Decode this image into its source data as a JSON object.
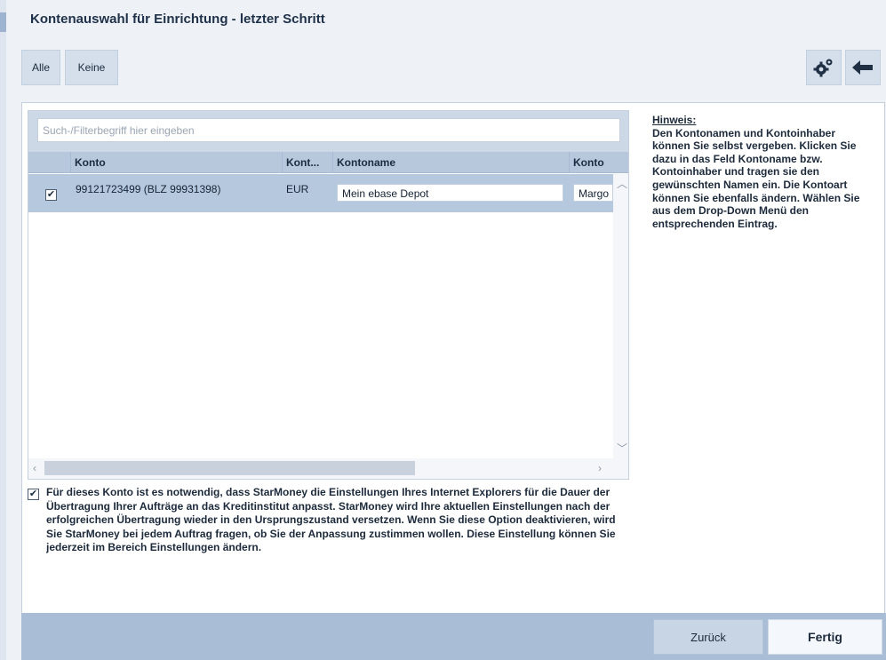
{
  "page": {
    "title": "Kontenauswahl für Einrichtung - letzter Schritt"
  },
  "toolbar": {
    "alle_label": "Alle",
    "keine_label": "Keine",
    "settings_icon": "gear-icon",
    "back_icon": "arrow-left-icon"
  },
  "grid": {
    "search_placeholder": "Such-/Filterbegriff hier eingeben",
    "columns": [
      "Konto",
      "Kont...",
      "Kontoname",
      "Konto"
    ],
    "rows": [
      {
        "checked": true,
        "konto": "99121723499 (BLZ 99931398)",
        "waehrung": "EUR",
        "kontoname": "Mein ebase Depot",
        "kontoinhaber": "Margo"
      }
    ]
  },
  "hint": {
    "title": "Hinweis:",
    "text": "Den Kontonamen und Kontoinhaber können Sie selbst vergeben. Klicken Sie dazu in das Feld Kontoname bzw. Kontoinhaber und tragen sie den gewünschten Namen ein. Die Kontoart können Sie ebenfalls ändern. Wählen Sie aus dem Drop-Down Menü den entsprechenden Eintrag."
  },
  "option": {
    "checked": true,
    "text": "Für dieses Konto ist es notwendig, dass StarMoney die Einstellungen Ihres Internet Explorers für die Dauer der Übertragung Ihrer Aufträge an das Kreditinstitut anpasst. StarMoney wird Ihre aktuellen Einstellungen nach der erfolgreichen Übertragung wieder in den Ursprungszustand versetzen. Wenn Sie diese Option deaktivieren, wird Sie StarMoney bei jedem Auftrag fragen, ob Sie der Anpassung zustimmen wollen. Diese Einstellung können Sie jederzeit im Bereich Einstellungen ändern."
  },
  "footer": {
    "zurueck_label": "Zurück",
    "fertig_label": "Fertig"
  }
}
